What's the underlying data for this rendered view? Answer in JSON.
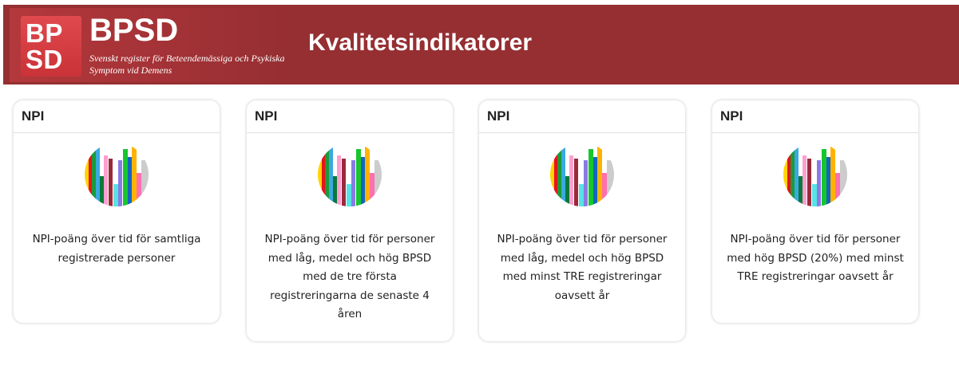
{
  "header": {
    "logo": {
      "mark_line1": "BP",
      "mark_line2": "SD",
      "title": "BPSD",
      "subtitle": "Svenskt register för Beteendemässiga och Psykiska Symptom vid Demens"
    },
    "page_title": "Kvalitetsindikatorer",
    "background_color": "#962f32"
  },
  "cards": [
    {
      "title": "NPI",
      "icon": "bar-chart-icon",
      "description": "NPI-poäng över tid för samtliga registrerade personer"
    },
    {
      "title": "NPI",
      "icon": "bar-chart-icon",
      "description": "NPI-poäng över tid för personer med låg, medel och hög BPSD med de tre första registreringarna de senaste 4 åren"
    },
    {
      "title": "NPI",
      "icon": "bar-chart-icon",
      "description": "NPI-poäng över tid för personer med låg, medel och hög BPSD med minst TRE registreringar oavsett år"
    },
    {
      "title": "NPI",
      "icon": "bar-chart-icon",
      "description": "NPI-poäng över tid för personer med hög BPSD (20%) med minst TRE registreringar oavsett år"
    }
  ]
}
